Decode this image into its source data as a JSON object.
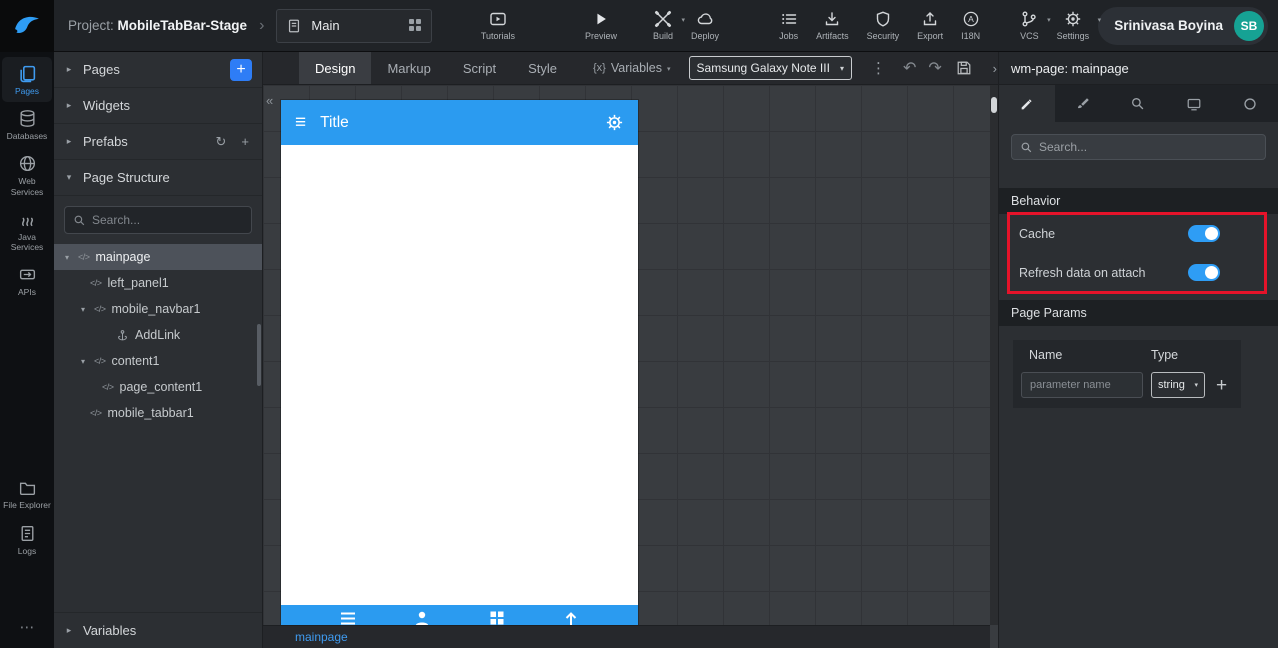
{
  "colors": {
    "accent": "#2e9df5",
    "annotation_red": "#e5132a",
    "phone_header_blue": "#2b9bf0",
    "avatar_teal": "#16a294"
  },
  "icons": {
    "caret_right": "▸",
    "caret_down": "▾",
    "select_caret": "▾",
    "collapse_left": "«",
    "expand_right": "›",
    "project_chevron": "›",
    "plus": "+",
    "refresh": "↻",
    "menu": "≡",
    "undo": "↶",
    "redo": "↷",
    "dots_vertical": "⋮",
    "dots_horizontal": "⋯",
    "code": "</>"
  },
  "topbar": {
    "project_label": "Project:",
    "project_name": "MobileTabBar-Stage",
    "page_selector": {
      "value": "Main"
    },
    "actions": [
      {
        "label": "Tutorials"
      },
      {
        "label": "Preview"
      },
      {
        "label": "Build",
        "dropdown": true
      },
      {
        "label": "Deploy"
      },
      {
        "label": "Jobs"
      },
      {
        "label": "Artifacts"
      },
      {
        "label": "Security"
      },
      {
        "label": "Export"
      },
      {
        "label": "I18N"
      },
      {
        "label": "VCS",
        "dropdown": true
      },
      {
        "label": "Settings",
        "dropdown": true
      }
    ],
    "user": {
      "name": "Srinivasa Boyina",
      "initials": "SB"
    }
  },
  "rail": {
    "items": [
      {
        "label": "Pages",
        "active": true
      },
      {
        "label": "Databases"
      },
      {
        "label": "Web Services"
      },
      {
        "label": "Java Services"
      },
      {
        "label": "APIs"
      },
      {
        "label": "File Explorer"
      },
      {
        "label": "Logs"
      }
    ]
  },
  "left_panel": {
    "pages": "Pages",
    "widgets": "Widgets",
    "prefabs": "Prefabs",
    "page_structure": "Page Structure",
    "variables": "Variables",
    "search_placeholder": "Search...",
    "tree": [
      {
        "label": "mainpage",
        "selected": true
      },
      {
        "label": "left_panel1"
      },
      {
        "label": "mobile_navbar1"
      },
      {
        "label": "AddLink"
      },
      {
        "label": "content1"
      },
      {
        "label": "page_content1"
      },
      {
        "label": "mobile_tabbar1"
      }
    ]
  },
  "canvas": {
    "tabs": [
      {
        "label": "Design",
        "active": true
      },
      {
        "label": "Markup"
      },
      {
        "label": "Script"
      },
      {
        "label": "Style"
      }
    ],
    "variables_prefix": "{x}",
    "variables_label": "Variables",
    "device": "Samsung Galaxy Note III",
    "breadcrumb": "mainpage",
    "phone": {
      "title": "Title"
    }
  },
  "right_panel": {
    "title": "wm-page: mainpage",
    "search_placeholder": "Search...",
    "behavior": {
      "title": "Behavior",
      "rows": [
        {
          "label": "Cache",
          "on": true
        },
        {
          "label": "Refresh data on attach",
          "on": true
        }
      ]
    },
    "page_params": {
      "title": "Page Params",
      "name_header": "Name",
      "type_header": "Type",
      "name_placeholder": "parameter name",
      "type_value": "string"
    }
  }
}
